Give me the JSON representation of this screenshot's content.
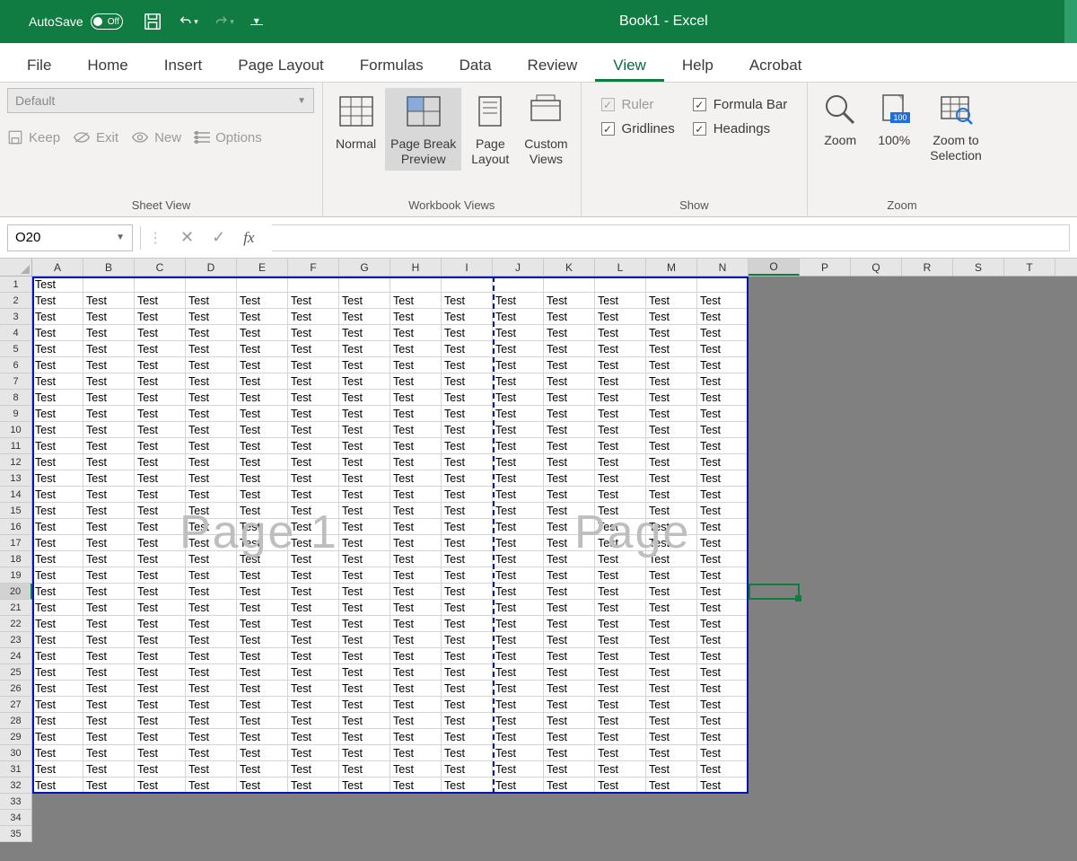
{
  "title_bar": {
    "autosave_label": "AutoSave",
    "autosave_state": "Off",
    "window_title": "Book1 - Excel"
  },
  "ribbon_tabs": {
    "file": "File",
    "home": "Home",
    "insert": "Insert",
    "page_layout": "Page Layout",
    "formulas": "Formulas",
    "data": "Data",
    "review": "Review",
    "view": "View",
    "help": "Help",
    "acrobat": "Acrobat",
    "active": "view"
  },
  "sheet_view": {
    "combo_value": "Default",
    "keep": "Keep",
    "exit": "Exit",
    "new": "New",
    "options": "Options",
    "group_label": "Sheet View"
  },
  "workbook_views": {
    "normal": "Normal",
    "page_break": "Page Break\nPreview",
    "page_layout": "Page\nLayout",
    "custom_views": "Custom\nViews",
    "group_label": "Workbook Views"
  },
  "show": {
    "ruler": "Ruler",
    "formula_bar": "Formula Bar",
    "gridlines": "Gridlines",
    "headings": "Headings",
    "group_label": "Show"
  },
  "zoom": {
    "zoom": "Zoom",
    "hundred": "100%",
    "to_selection": "Zoom to\nSelection",
    "group_label": "Zoom"
  },
  "formula_bar": {
    "name_box": "O20",
    "fx": "fx"
  },
  "grid": {
    "columns": [
      "A",
      "B",
      "C",
      "D",
      "E",
      "F",
      "G",
      "H",
      "I",
      "J",
      "K",
      "L",
      "M",
      "N",
      "O",
      "P",
      "Q",
      "R",
      "S",
      "T"
    ],
    "row_count": 35,
    "cell_value": "Test",
    "watermark1": "Page 1",
    "watermark2": "Page",
    "data_cols": 14,
    "data_rows_start": 1,
    "data_rows_end": 32,
    "row1_single_col": true,
    "selected_cell_ref": "O20",
    "selected_col_index": 14,
    "selected_row_index": 19,
    "page_break_after_col": 9
  }
}
